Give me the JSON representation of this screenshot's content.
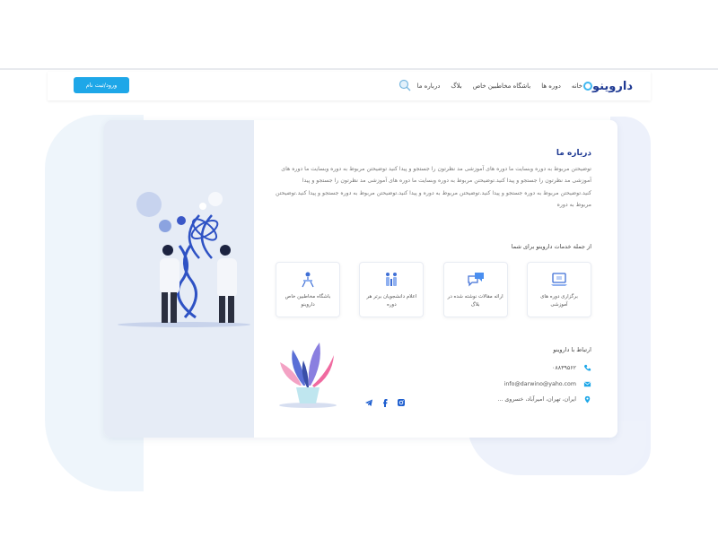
{
  "header": {
    "logo_text": "داروینو",
    "nav": [
      "خانه",
      "دوره ها",
      "باشگاه مخاطبین خاص",
      "بلاگ",
      "درباره ما"
    ],
    "register_button": "ورود/ثبت نام"
  },
  "about": {
    "title": "درباره ما",
    "text": "توضیحتن مربوط به دوره  وبسایت ما دوره های آموزشی مد نظرتون را جستجو و پیدا کنید توضیحتن مربوط به دوره  وبسایت ما دوره های آموزشی مد نظرتون را جستجو و پیدا کنید.توضیحتن مربوط به دوره  وبسایت ما دوره های آموزشی مد نظرتون را جستجو و پیدا کنید.توضیحتن مربوط به دوره جستجو و پیدا کنید.توضیحتن مربوط به دوره و پیدا کنید.توضیحتن مربوط به دوره جستجو و پیدا کنید.توضیحتن مربوط به دوره"
  },
  "services": {
    "title": "از جمله خدمات داروینو برای شما",
    "items": [
      {
        "label": "برگزاری دوره های آموزشی",
        "icon": "laptop-icon"
      },
      {
        "label": "ارائه مقالات نوشته شده در بلاگ",
        "icon": "chat-icon"
      },
      {
        "label": "اعلام دانشجویان برتر هر دوره",
        "icon": "students-icon"
      },
      {
        "label": "باشگاه مخاطبین خاص داروینو",
        "icon": "club-icon"
      }
    ]
  },
  "contact": {
    "title": "ارتباط با داروینو",
    "phone": "۰۸۸۳۹۵۶۲",
    "email": "info@darwino@yaho.com",
    "address": "ایران، تهران، امیرآباد، خسروی ..."
  },
  "colors": {
    "primary": "#1f3a93",
    "accent": "#1ea7e8",
    "panel": "#e6ecf6"
  },
  "icons": {
    "search": "search-icon",
    "phone": "phone-icon",
    "mail": "mail-icon",
    "location": "location-icon",
    "telegram": "telegram-icon",
    "facebook": "facebook-icon",
    "instagram": "instagram-icon"
  }
}
